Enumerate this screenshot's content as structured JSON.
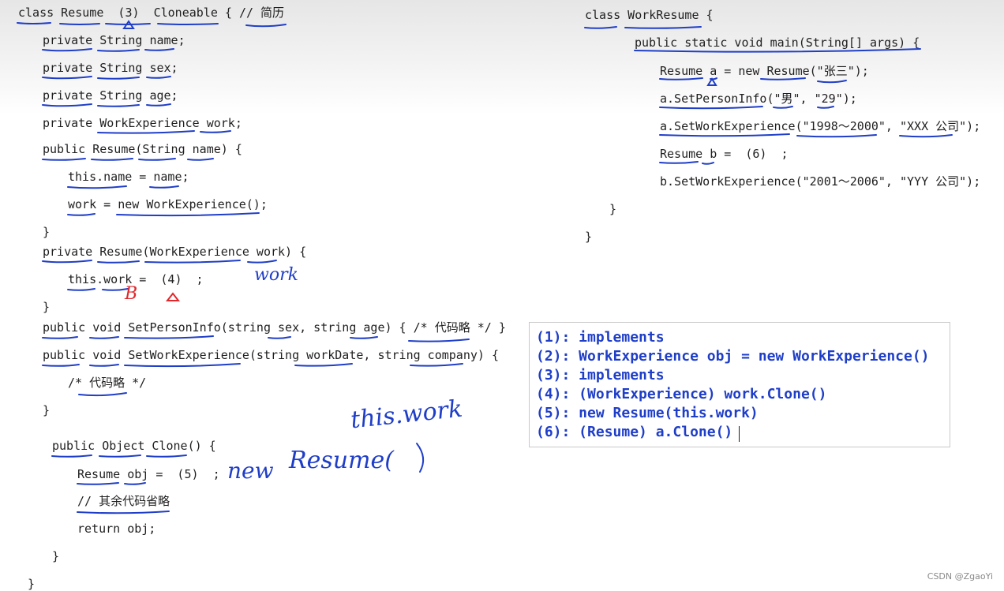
{
  "left_code": {
    "l1": "class Resume  (3)  Cloneable { // 简历",
    "l2": "private String name;",
    "l3": "private String sex;",
    "l4": "private String age;",
    "l5": "private WorkExperience work;",
    "l6": "public Resume(String name) {",
    "l7": "this.name = name;",
    "l8": "work = new WorkExperience();",
    "l9": "}",
    "l10": "private Resume(WorkExperience work) {",
    "l11": "this.work =  (4)  ;",
    "l12": "}",
    "l13": "public void SetPersonInfo(string sex, string age) { /* 代码略 */ }",
    "l14": "public void SetWorkExperience(string workDate, string company) {",
    "l15": "/* 代码略 */",
    "l16": "}",
    "l17": "public Object Clone() {",
    "l18": "Resume obj =  (5)  ;",
    "l19": "// 其余代码省略",
    "l20": "return obj;",
    "l21": "}",
    "l22": "}"
  },
  "right_code": {
    "r1": "class WorkResume {",
    "r2": "public static void main(String[] args) {",
    "r3": "Resume a = new Resume(\"张三\");",
    "r4": "a.SetPersonInfo(\"男\", \"29\");",
    "r5": "a.SetWorkExperience(\"1998～2000\", \"XXX 公司\");",
    "r6": "Resume b =  (6)  ;",
    "r7": "b.SetWorkExperience(\"2001～2006\", \"YYY 公司\");",
    "r8": "}",
    "r9": "}"
  },
  "handwriting": {
    "work_note": "work",
    "b_note": "B",
    "this_work_note": "this.work",
    "new_note": "new",
    "resume_note": "Resume(",
    "paren_note": ")"
  },
  "answers": [
    "(1): implements",
    "(2): WorkExperience obj = new WorkExperience()",
    "(3): implements",
    "(4): (WorkExperience) work.Clone()",
    "(5): new Resume(this.work)",
    "(6): (Resume) a.Clone()"
  ],
  "watermark": "CSDN @ZgaoYi",
  "colors": {
    "ink_blue": "#1f3ec8",
    "ink_red": "#e0282c",
    "code_text": "#1f1f1f"
  }
}
